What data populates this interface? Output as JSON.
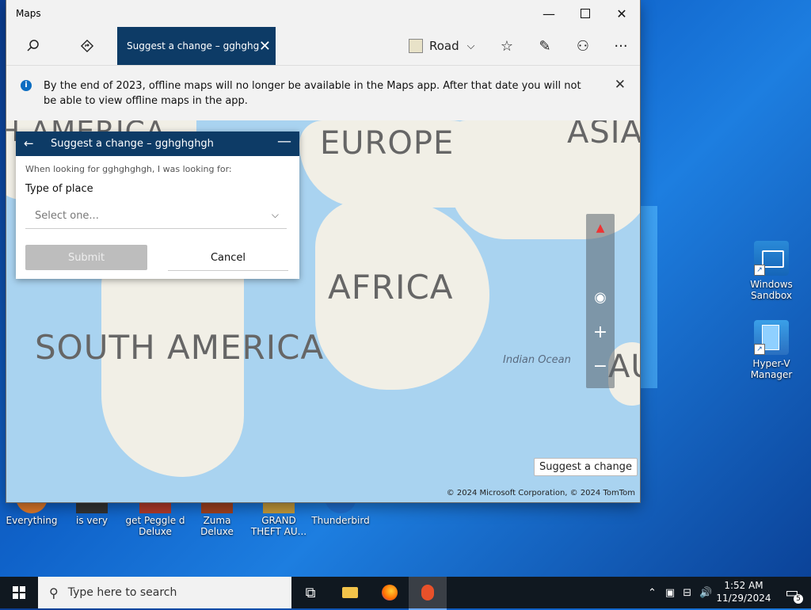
{
  "window": {
    "title": "Maps"
  },
  "toolbar": {
    "active_tab": "Suggest a change – gghghg",
    "map_style": "Road"
  },
  "notice": {
    "message": "By the end of 2023, offline maps will no longer be available in the Maps app. After that date you will not be able to view offline maps in the app."
  },
  "map": {
    "labels": {
      "north_america": "H AMERICA",
      "europe": "EUROPE",
      "asia": "ASIA",
      "africa": "AFRICA",
      "south_america": "SOUTH AMERICA",
      "australia": "AU",
      "indian_ocean": "Indian Ocean"
    },
    "suggest_button": "Suggest a change",
    "copyright": "© 2024 Microsoft Corporation, © 2024 TomTom"
  },
  "panel": {
    "title": "Suggest a change – gghghghgh",
    "hint": "When looking for gghghghgh, I was looking for:",
    "type_label": "Type of place",
    "select_placeholder": "Select one...",
    "submit": "Submit",
    "cancel": "Cancel"
  },
  "desktop": {
    "icons": [
      {
        "label": "Windows Sandbox"
      },
      {
        "label": "Hyper-V Manager"
      }
    ],
    "bottom_icons": [
      {
        "label": "Everything"
      },
      {
        "label": "is very"
      },
      {
        "label": "get Peggle d Deluxe"
      },
      {
        "label": "Zuma Deluxe"
      },
      {
        "label": "GRAND THEFT AU..."
      },
      {
        "label": "Thunderbird"
      }
    ]
  },
  "taskbar": {
    "search_placeholder": "Type here to search",
    "time": "1:52 AM",
    "date": "11/29/2024",
    "notification_count": "5"
  },
  "colors": {
    "accent": "#0d3b66",
    "map_water": "#a9d3f0",
    "map_land": "#f1efe6"
  }
}
